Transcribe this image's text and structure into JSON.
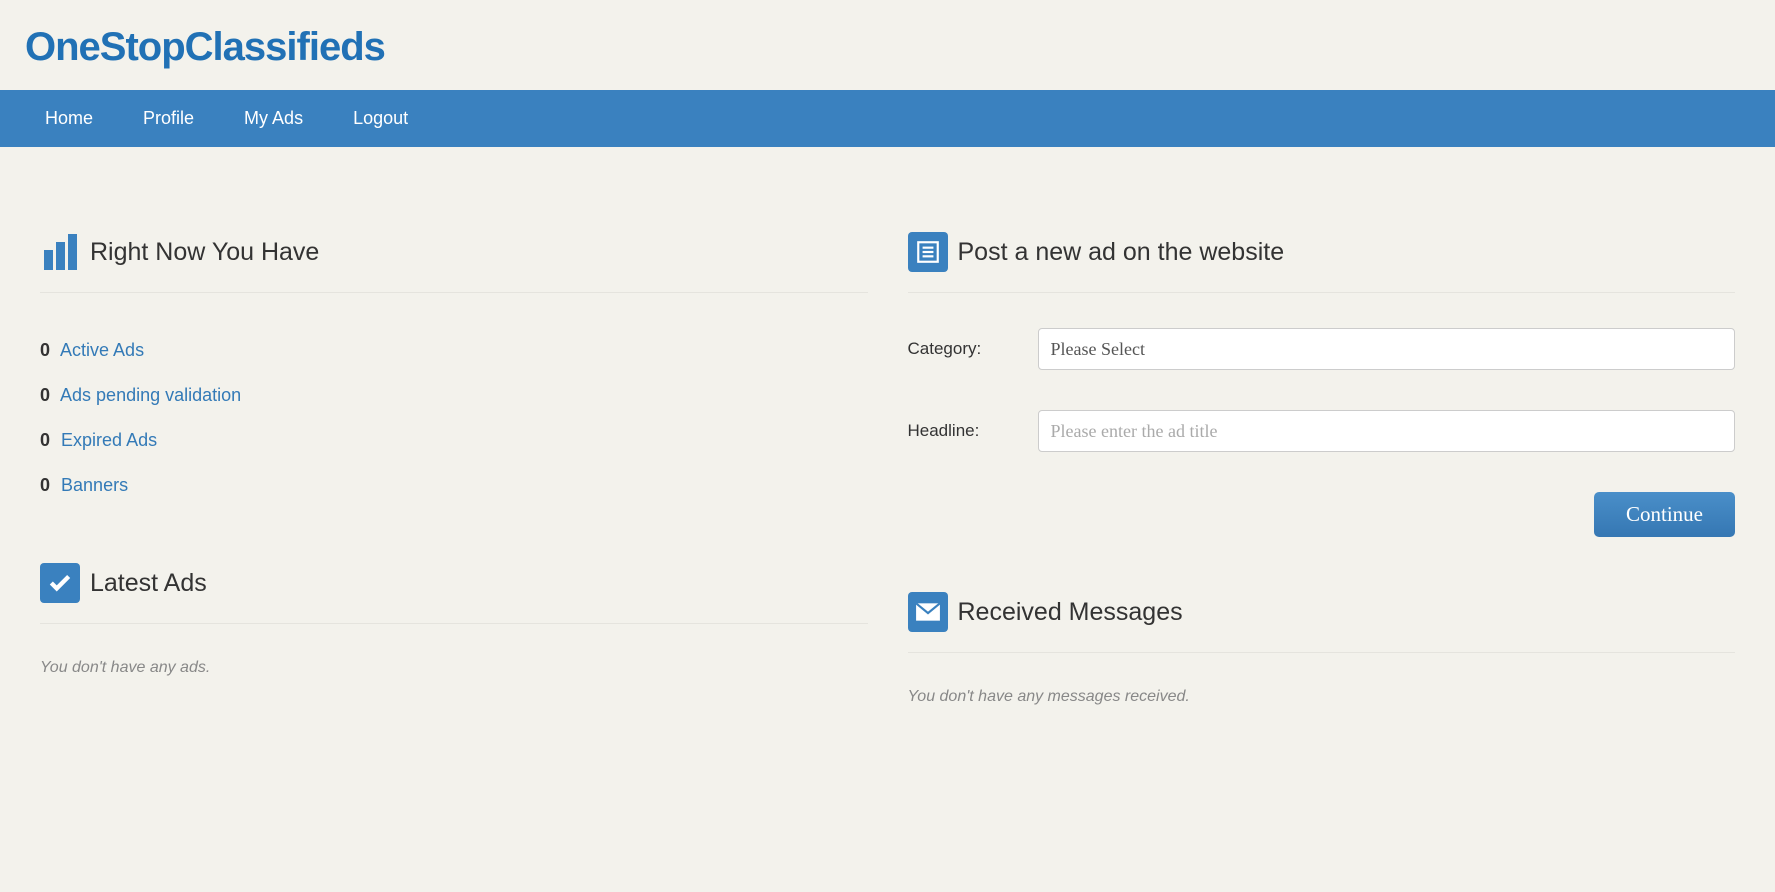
{
  "logo": {
    "part1": "One",
    "part2": "Stop",
    "part3": "Classifieds"
  },
  "nav": [
    "Home",
    "Profile",
    "My Ads",
    "Logout"
  ],
  "stats": {
    "heading": "Right Now You Have",
    "items": [
      {
        "count": "0",
        "label": "Active Ads"
      },
      {
        "count": "0",
        "label": "Ads pending validation"
      },
      {
        "count": "0",
        "label": "Expired Ads"
      },
      {
        "count": "0",
        "label": "Banners"
      }
    ]
  },
  "latest": {
    "heading": "Latest Ads",
    "empty": "You don't have any ads."
  },
  "post": {
    "heading": "Post a new ad on the website",
    "category_label": "Category:",
    "category_value": "Please Select",
    "headline_label": "Headline:",
    "headline_placeholder": "Please enter the ad title",
    "continue": "Continue"
  },
  "messages": {
    "heading": "Received Messages",
    "empty": "You don't have any messages received."
  }
}
